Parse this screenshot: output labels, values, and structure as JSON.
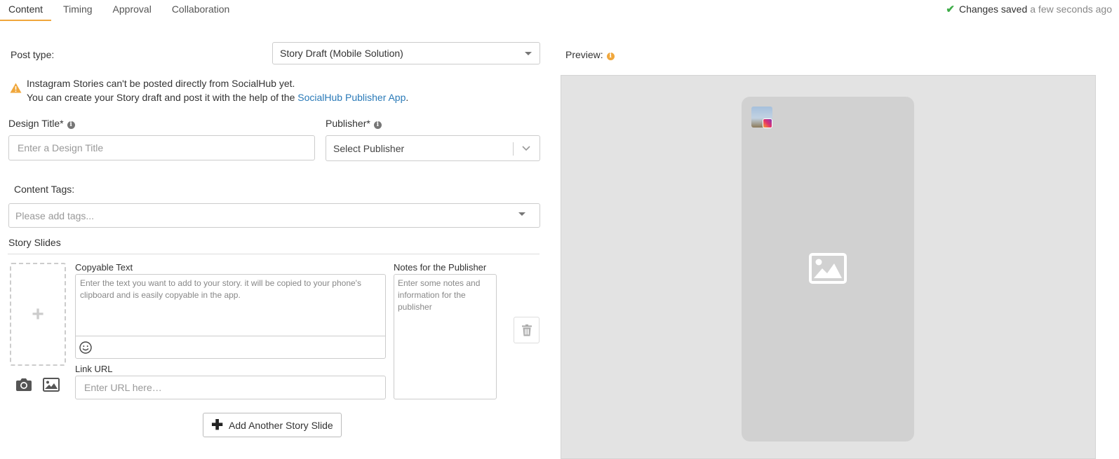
{
  "tabs": [
    {
      "label": "Content",
      "active": true
    },
    {
      "label": "Timing",
      "active": false
    },
    {
      "label": "Approval",
      "active": false
    },
    {
      "label": "Collaboration",
      "active": false
    }
  ],
  "status": {
    "saved_label": "Changes saved",
    "saved_time": "a few seconds ago"
  },
  "post_type": {
    "label": "Post type:",
    "value": "Story Draft (Mobile Solution)"
  },
  "preview": {
    "label": "Preview:"
  },
  "warning": {
    "line1": "Instagram Stories can't be posted directly from SocialHub yet.",
    "line2_prefix": "You can create your Story draft and post it with the help of the ",
    "link_text": "SocialHub Publisher App",
    "line2_suffix": "."
  },
  "design_title": {
    "label": "Design Title*",
    "placeholder": "Enter a Design Title"
  },
  "publisher": {
    "label": "Publisher*",
    "placeholder": "Select Publisher"
  },
  "content_tags": {
    "label": "Content Tags:",
    "placeholder": "Please add tags..."
  },
  "story_slides": {
    "heading": "Story Slides",
    "copyable_text_label": "Copyable Text",
    "copyable_text_placeholder": "Enter the text you want to add to your story. it will be copied to your phone's clipboard and is easily copyable in the app.",
    "link_url_label": "Link URL",
    "link_url_placeholder": "Enter URL here…",
    "notes_label": "Notes for the Publisher",
    "notes_placeholder": "Enter some notes and information for the publisher",
    "add_button": "Add Another Story Slide"
  },
  "colors": {
    "accent": "#f0a73c",
    "link": "#2a7ab8",
    "success": "#3eac48"
  },
  "icons": [
    "check-icon",
    "info-icon",
    "warning-icon",
    "chevron-down-icon",
    "plus-icon",
    "camera-icon",
    "image-icon",
    "smiley-icon",
    "trash-icon",
    "instagram-icon",
    "image-placeholder-icon"
  ]
}
